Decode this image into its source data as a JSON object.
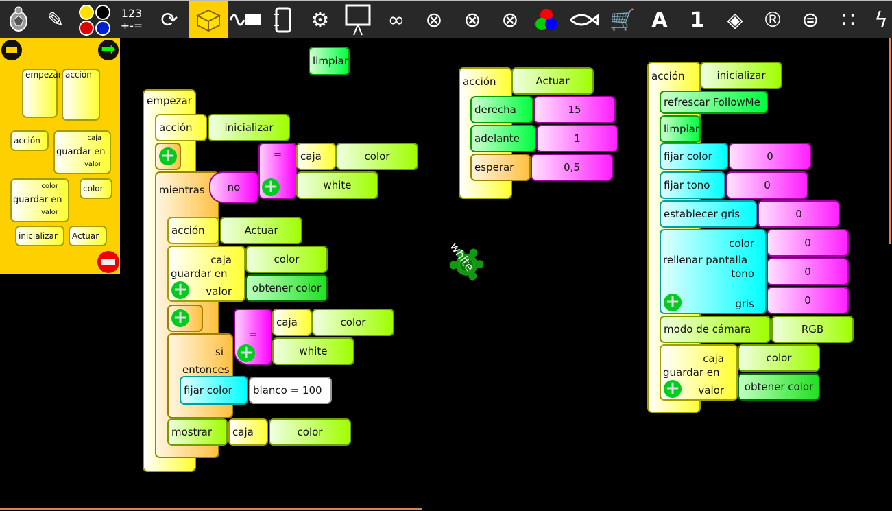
{
  "toolbar": {
    "numbers_label": "123",
    "ops_label": "+-=",
    "items": [
      "turtle-icon",
      "pen-icon",
      "colors-icon",
      "numbers-icon",
      "flow-icon",
      "blocks-icon",
      "sensors-icon",
      "media-icon",
      "extras-icon",
      "presentation-icon",
      "arduino-icon",
      "butia-icon",
      "butia-e-icon",
      "butia-c-icon",
      "rgb-icon",
      "fish-icon",
      "cart-icon",
      "followme-a-icon",
      "followme-1-icon",
      "diamond-icon",
      "r-icon",
      "equal-icon",
      "dots-icon",
      "x-wave-icon"
    ],
    "selected": "blocks-icon"
  },
  "palette": {
    "blocks": [
      "empezar",
      "acción",
      "acción",
      "caja",
      "guardar en",
      "valor",
      "color",
      "guardar en",
      "valor",
      "color",
      "inicializar",
      "Actuar"
    ]
  },
  "stack1": {
    "empezar": "empezar",
    "accion": "acción",
    "accion_name": "inicializar",
    "mientras": "mientras",
    "no": "no",
    "eq": "=",
    "caja": "caja",
    "color": "color",
    "white": "white",
    "accion2": "acción",
    "actuar": "Actuar",
    "guardar": "guardar en",
    "caja_lbl": "caja",
    "valor_lbl": "valor",
    "color2": "color",
    "obtener": "obtener color",
    "si": "si",
    "entonces": "entonces",
    "eq2": "=",
    "caja2": "caja",
    "color3": "color",
    "white2": "white",
    "fijar": "fijar color",
    "blanco": "blanco = 100",
    "mostrar": "mostrar",
    "caja3": "caja",
    "color4": "color"
  },
  "limpiar": "limpiar",
  "stack2": {
    "accion": "acción",
    "name": "Actuar",
    "derecha": "derecha",
    "derecha_val": "15",
    "adelante": "adelante",
    "adelante_val": "1",
    "esperar": "esperar",
    "esperar_val": "0,5"
  },
  "stack3": {
    "accion": "acción",
    "name": "inicializar",
    "refrescar": "refrescar FollowMe",
    "limpiar": "limpiar",
    "fijar_color": "fijar color",
    "fijar_color_val": "0",
    "fijar_tono": "fijar tono",
    "fijar_tono_val": "0",
    "gris": "establecer gris",
    "gris_val": "0",
    "rellenar": "rellenar pantalla",
    "color_lbl": "color",
    "tono_lbl": "tono",
    "gris_lbl": "gris",
    "r_color": "0",
    "r_tono": "0",
    "r_gris": "0",
    "modo": "modo de cámara",
    "modo_val": "RGB",
    "guardar": "guardar en",
    "caja_lbl": "caja",
    "valor_lbl": "valor",
    "color": "color",
    "obtener": "obtener color"
  },
  "turtle": {
    "label": "white",
    "color": "#119911"
  },
  "colors": {
    "accent": "#ffd000",
    "toolbar": "#282828"
  }
}
